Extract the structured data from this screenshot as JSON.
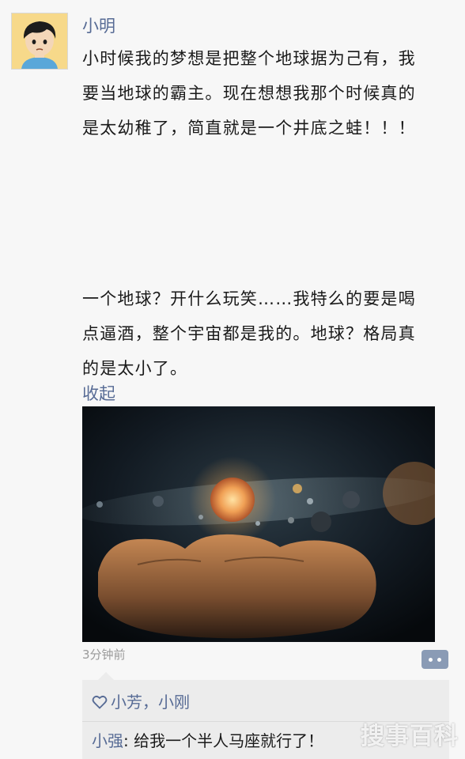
{
  "post": {
    "username": "小明",
    "paragraph1": "小时候我的梦想是把整个地球据为己有，我\n要当地球的霸主。现在想想我那个时候真的\n是太幼稚了，简直就是一个井底之蛙！！！",
    "paragraph2": "一个地球？开什么玩笑……我特么的要是喝\n点逼酒，整个宇宙都是我的。地球？格局真\n的是太小了。",
    "collapse_label": "收起",
    "image_icon": "planet-in-hand-photo",
    "timestamp": "3分钟前"
  },
  "interactions": {
    "likes": "小芳，小刚",
    "comment_author": "小强",
    "comment_separator": ": ",
    "comment_text": "给我一个半人马座就行了！"
  },
  "watermark": "搜事百科",
  "colors": {
    "link": "#576b95",
    "background": "#f7f7f7",
    "comment_bg": "#ececec"
  }
}
